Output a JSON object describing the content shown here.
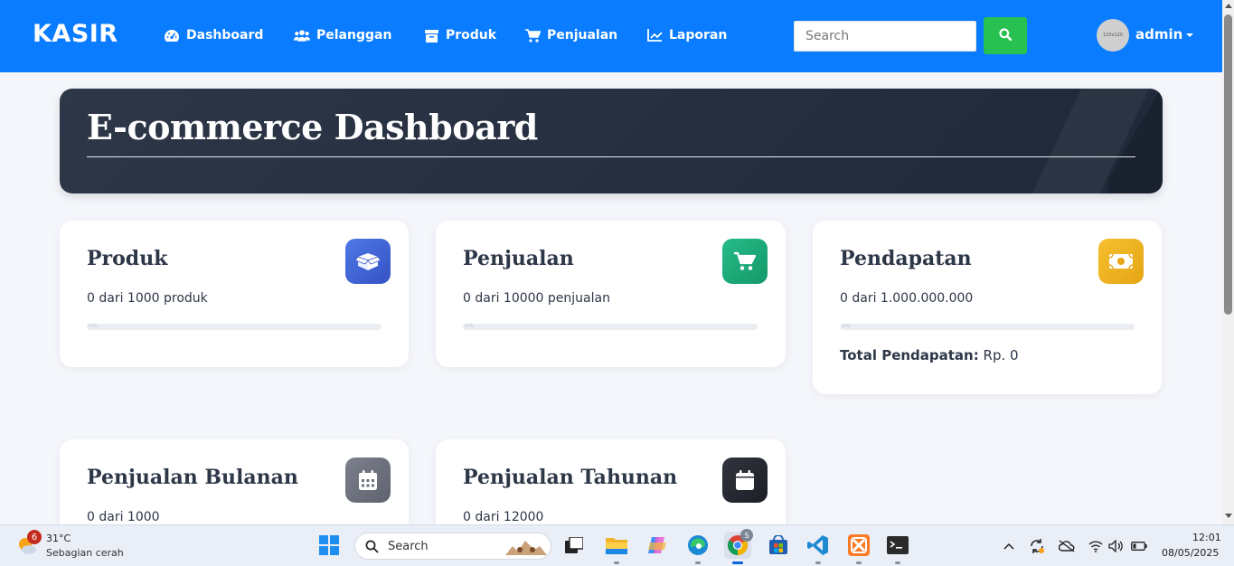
{
  "navbar": {
    "brand": "KASIR",
    "items": [
      {
        "label": "Dashboard",
        "icon": "gauge-icon"
      },
      {
        "label": "Pelanggan",
        "icon": "users-icon"
      },
      {
        "label": "Produk",
        "icon": "box-icon"
      },
      {
        "label": "Penjualan",
        "icon": "cart-icon"
      },
      {
        "label": "Laporan",
        "icon": "line-chart-icon"
      }
    ],
    "search_placeholder": "Search",
    "search_value": "",
    "avatar_text": "120x120",
    "user_name": "admin",
    "colors": {
      "bar": "#0a7cff",
      "search_button": "#28c050"
    }
  },
  "hero": {
    "title": "E-commerce Dashboard"
  },
  "cards": [
    {
      "title": "Produk",
      "subtitle": "0 dari 1000 produk",
      "progress_percent": 0,
      "progress_label": "0%",
      "icon": "box-open-icon",
      "icon_color": "#4166d5"
    },
    {
      "title": "Penjualan",
      "subtitle": "0 dari 10000 penjualan",
      "progress_percent": 0,
      "progress_label": "0%",
      "icon": "cart-icon",
      "icon_color": "#1ea97c"
    },
    {
      "title": "Pendapatan",
      "subtitle": "0 dari 1.000.000.000",
      "progress_percent": 0,
      "progress_label": "0%",
      "icon": "money-icon",
      "icon_color": "#f0b41c",
      "total_label": "Total Pendapatan:",
      "total_value": "Rp. 0"
    },
    {
      "title": "Penjualan Bulanan",
      "subtitle": "0 dari 1000",
      "icon": "calendar-days-icon",
      "icon_color": "#6e7380"
    },
    {
      "title": "Penjualan Tahunan",
      "subtitle": "0 dari 12000",
      "icon": "calendar-icon",
      "icon_color": "#262a33"
    }
  ],
  "taskbar": {
    "weather_badge": "6",
    "weather_temp": "31°C",
    "weather_desc": "Sebagian cerah",
    "search_label": "Search",
    "apps": [
      "windows-start-icon",
      "task-view-icon",
      "file-explorer-icon",
      "copilot-icon",
      "edge-icon",
      "chrome-icon",
      "store-icon",
      "vscode-icon",
      "xampp-icon",
      "terminal-icon"
    ],
    "chrome_badge": "S",
    "clock_time": "12:01",
    "clock_date": "08/05/2025"
  }
}
